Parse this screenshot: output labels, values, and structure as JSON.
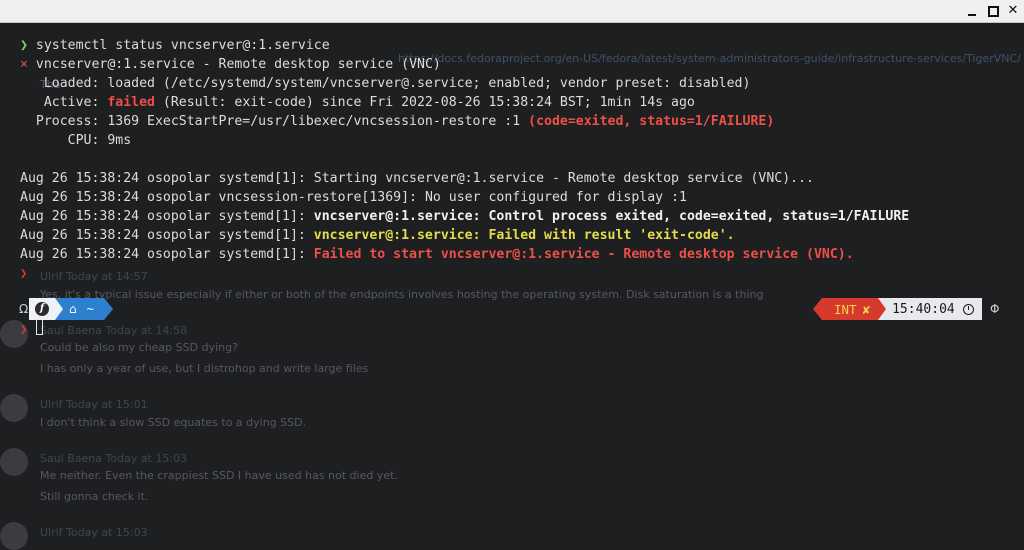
{
  "window": {
    "controls": [
      "minimize",
      "maximize",
      "close"
    ],
    "close_glyph": "✕"
  },
  "terminal": {
    "prompt_arrow": "❯",
    "command": "systemctl status vncserver@:1.service",
    "status_mark": "×",
    "unit_line": "vncserver@:1.service - Remote desktop service (VNC)",
    "loaded": "   Loaded: loaded (/etc/systemd/system/vncserver@.service; enabled; vendor preset: disabled)",
    "active_label": "   Active: ",
    "active_state": "failed",
    "active_rest": " (Result: exit-code) since Fri 2022-08-26 15:38:24 BST; 1min 14s ago",
    "process_prefix": "  Process: 1369 ExecStartPre=/usr/libexec/vncsession-restore :1 ",
    "process_status": "(code=exited, status=1/FAILURE)",
    "cpu": "      CPU: 9ms",
    "log_prefix": "Aug 26 15:38:24 osopolar ",
    "logs": [
      {
        "src": "systemd[1]: ",
        "msg": "Starting vncserver@:1.service - Remote desktop service (VNC)...",
        "style": "normal"
      },
      {
        "src": "vncsession-restore[1369]: ",
        "msg": "No user configured for display :1",
        "style": "normal"
      },
      {
        "src": "systemd[1]: ",
        "msg": "vncserver@:1.service: Control process exited, code=exited, status=1/FAILURE",
        "style": "bold"
      },
      {
        "src": "systemd[1]: ",
        "msg": "vncserver@:1.service: Failed with result 'exit-code'.",
        "style": "yellow"
      },
      {
        "src": "systemd[1]: ",
        "msg": "Failed to start vncserver@:1.service - Remote desktop service (VNC).",
        "style": "red"
      }
    ]
  },
  "prompt_bar": {
    "left_edge": "Ω",
    "os_icon": "fedora-icon",
    "os_glyph": "f",
    "home_glyph": "⌂",
    "dir": "~",
    "status": "INT",
    "status_mark": "✘",
    "time": "15:40:04",
    "right_edge": "Φ"
  },
  "background_chat": {
    "url": "https://docs.fedoraproject.org/en-US/fedora/latest/system-administrators-guide/infrastructure-services/TigerVNC/",
    "fragment": "Tha",
    "marker": "❯",
    "msg1_header": "Ulrif   Today at 14:57",
    "msg1_text": "Yes, it's a typical issue especially if either or both of the endpoints involves hosting the operating system. Disk saturation is a thing",
    "msg2_header": "Saul Baena   Today at 14:58",
    "msg2_line1": "Could be also my cheap SSD dying?",
    "msg2_line2": "I has only a year of use, but I distrohop and write large files",
    "msg3_header": "Ulrif   Today at 15:01",
    "msg3_line1": "I don't think a slow SSD equates to a dying SSD.",
    "msg4_header": "Saul Baena   Today at 15:03",
    "msg4_line1": "Me neither. Even the crappiest SSD I have used has not died yet.",
    "msg4_line2": "Still gonna check it.",
    "msg5_header": "Ulrif   Today at 15:03"
  }
}
